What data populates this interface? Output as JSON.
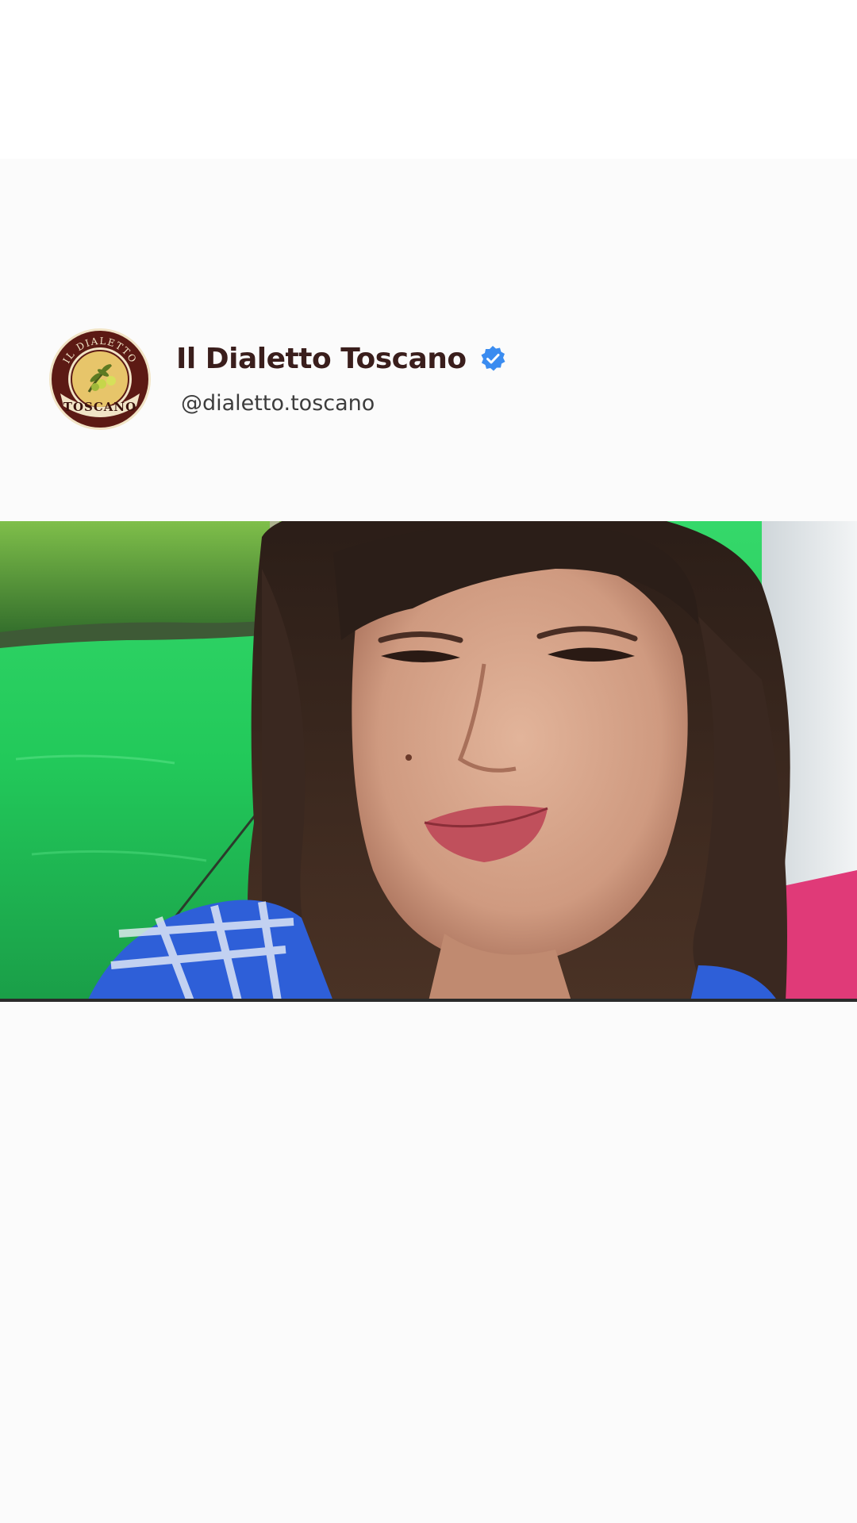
{
  "profile": {
    "account_name": "Il Dialetto Toscano",
    "handle": "@dialetto.toscano",
    "verified": true,
    "avatar_icon": "il-dialetto-toscano-logo-icon",
    "avatar_text_top": "IL DIALETTO",
    "avatar_text_bottom": "TOSCANO"
  },
  "video": {
    "description_icon": "video-frame-woman-on-boat-icon"
  },
  "colors": {
    "name_text": "#3a1e1c",
    "handle_text": "#3d3d3d",
    "verified_badge": "#3b8cf0",
    "logo_ring": "#5c1a14",
    "logo_inner": "#e7c56a",
    "background": "#fbfbfb"
  }
}
